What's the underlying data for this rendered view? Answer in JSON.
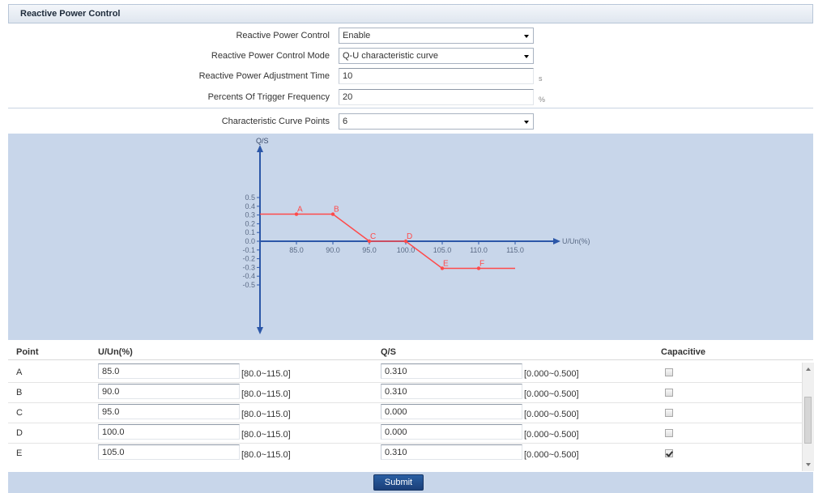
{
  "panel": {
    "title": "Reactive Power Control"
  },
  "form": {
    "reactive_power_control": {
      "label": "Reactive Power Control",
      "value": "Enable"
    },
    "control_mode": {
      "label": "Reactive Power Control Mode",
      "value": "Q-U characteristic curve"
    },
    "adjustment_time": {
      "label": "Reactive Power Adjustment Time",
      "value": "10",
      "unit": "s"
    },
    "trigger_frequency": {
      "label": "Percents Of Trigger Frequency",
      "value": "20",
      "unit": "%"
    },
    "curve_points": {
      "label": "Characteristic Curve Points",
      "value": "6"
    }
  },
  "chart_data": {
    "type": "line",
    "ylabel": "Q/S",
    "xlabel": "U/Un(%)",
    "x_ticks": [
      "85.0",
      "90.0",
      "95.0",
      "100.0",
      "105.0",
      "110.0",
      "115.0"
    ],
    "y_ticks": [
      "0.5",
      "0.4",
      "0.3",
      "0.2",
      "0.1",
      "0.0",
      "-0.1",
      "-0.2",
      "-0.3",
      "-0.4",
      "-0.5"
    ],
    "x_range": [
      80,
      115
    ],
    "ylim": [
      -0.5,
      0.5
    ],
    "points": [
      {
        "label": "A",
        "x": 85.0,
        "y": 0.31
      },
      {
        "label": "B",
        "x": 90.0,
        "y": 0.31
      },
      {
        "label": "C",
        "x": 95.0,
        "y": 0.0
      },
      {
        "label": "D",
        "x": 100.0,
        "y": 0.0
      },
      {
        "label": "E",
        "x": 105.0,
        "y": -0.31
      },
      {
        "label": "F",
        "x": 110.0,
        "y": -0.31
      }
    ],
    "line_start_x": 80.0,
    "line_end_x": 115.0,
    "line_color": "#ff4a4a",
    "axis_color": "#2c57a8"
  },
  "table": {
    "headers": {
      "point": "Point",
      "u_un": "U/Un(%)",
      "q_s": "Q/S",
      "capacitive": "Capacitive"
    },
    "rows": [
      {
        "point": "A",
        "u": "85.0",
        "u_range": "[80.0~115.0]",
        "q": "0.310",
        "q_range": "[0.000~0.500]",
        "capacitive": false
      },
      {
        "point": "B",
        "u": "90.0",
        "u_range": "[80.0~115.0]",
        "q": "0.310",
        "q_range": "[0.000~0.500]",
        "capacitive": false
      },
      {
        "point": "C",
        "u": "95.0",
        "u_range": "[80.0~115.0]",
        "q": "0.000",
        "q_range": "[0.000~0.500]",
        "capacitive": false
      },
      {
        "point": "D",
        "u": "100.0",
        "u_range": "[80.0~115.0]",
        "q": "0.000",
        "q_range": "[0.000~0.500]",
        "capacitive": false
      },
      {
        "point": "E",
        "u": "105.0",
        "u_range": "[80.0~115.0]",
        "q": "0.310",
        "q_range": "[0.000~0.500]",
        "capacitive": true
      }
    ]
  },
  "actions": {
    "submit_label": "Submit"
  }
}
